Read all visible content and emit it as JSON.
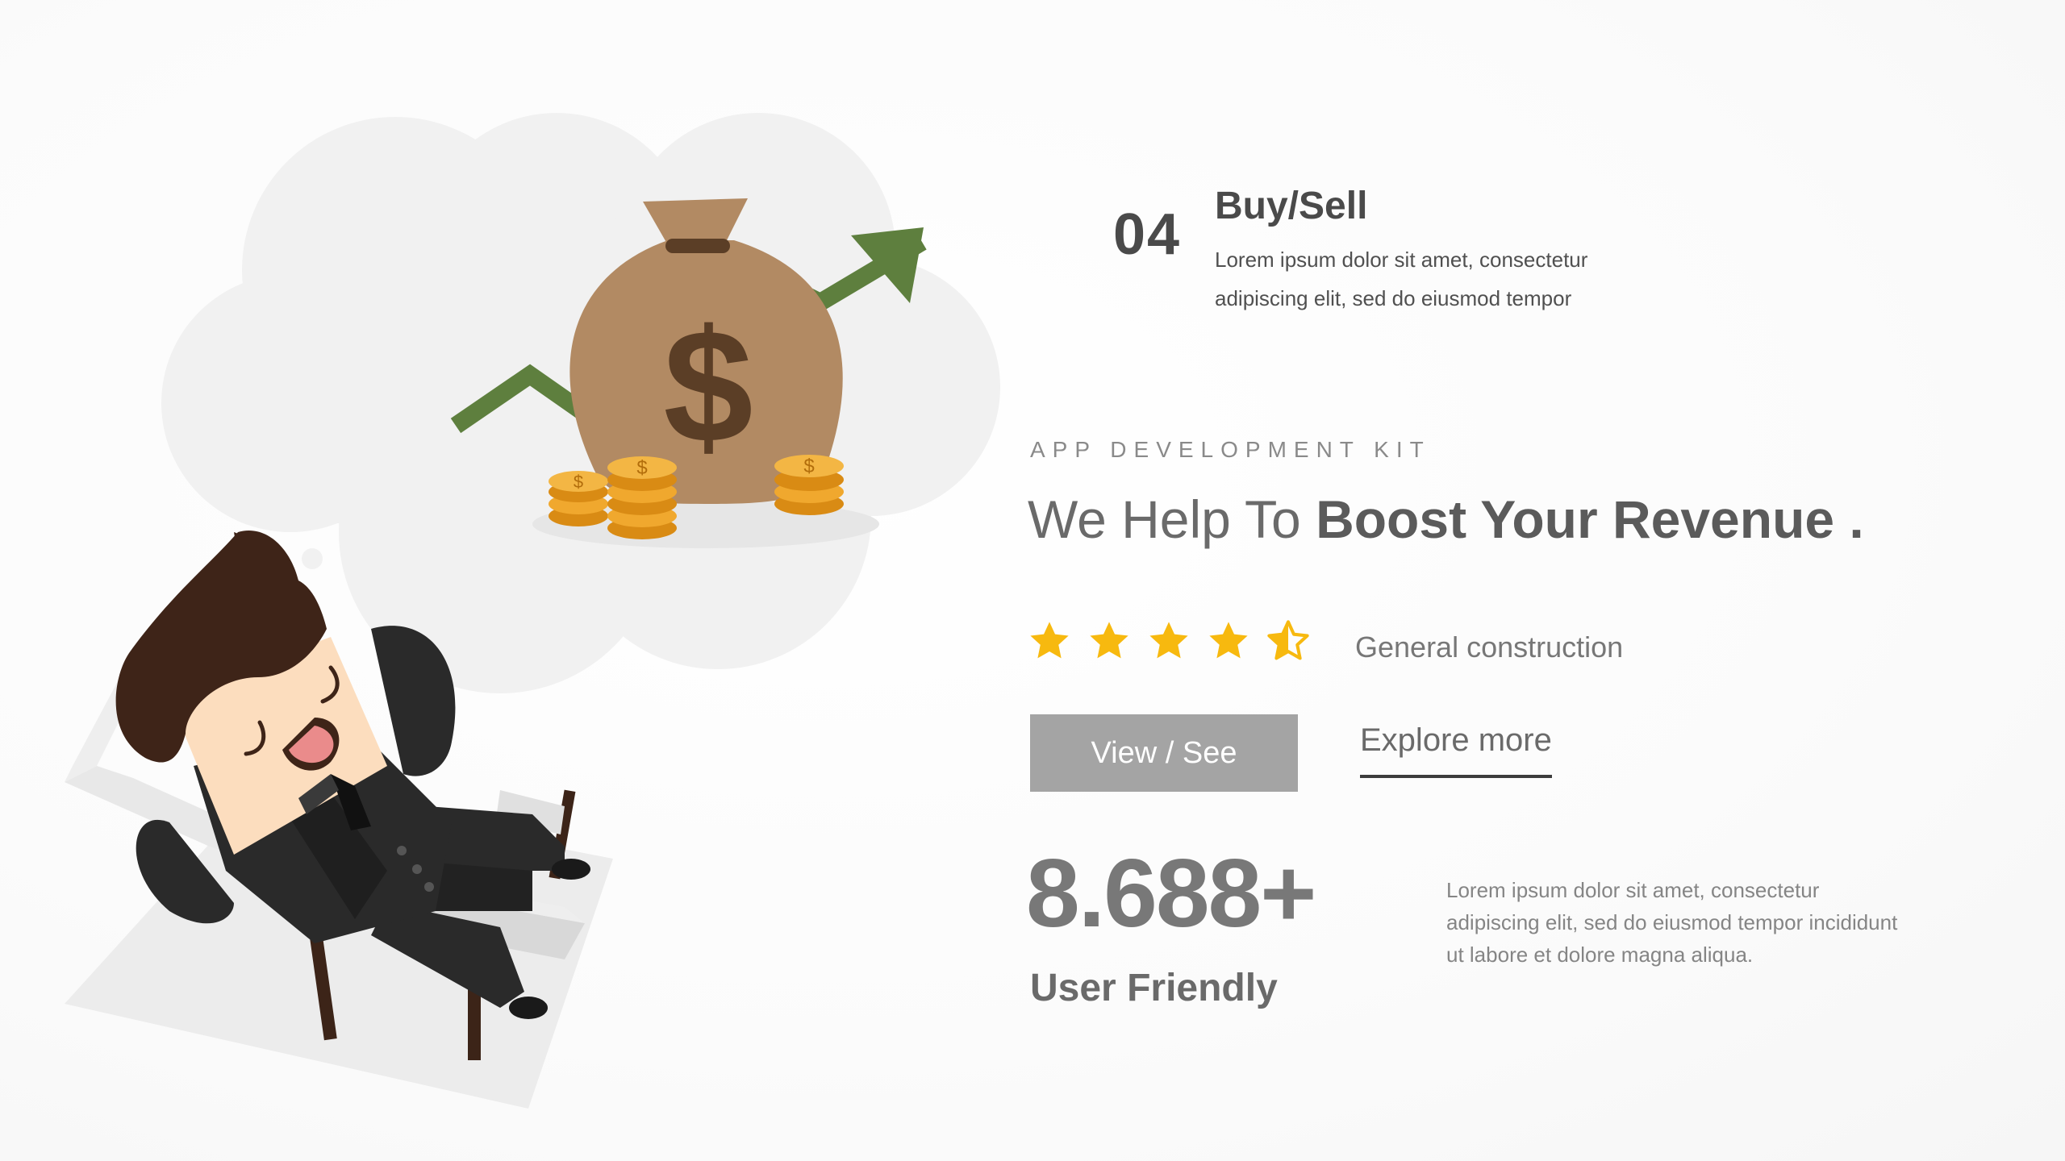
{
  "step": {
    "number": "04",
    "title": "Buy/Sell",
    "description": "Lorem ipsum dolor sit amet, consectetur adipiscing elit, sed do eiusmod tempor"
  },
  "hero": {
    "kicker": "APP DEVELOPMENT KIT",
    "headline_light": "We Help To ",
    "headline_bold": "Boost Your Revenue .",
    "rating": 4.5,
    "rating_max": 5,
    "rating_label": "General construction",
    "primary_button": "View / See",
    "secondary_link": "Explore more"
  },
  "stat": {
    "value": "8.688+",
    "label": "User Friendly",
    "description": "Lorem ipsum dolor sit amet, consectetur adipiscing elit, sed do eiusmod tempor incididunt ut labore et dolore magna aliqua."
  },
  "colors": {
    "star": "#F7B90F",
    "button": "#A4A4A4",
    "money_bag": "#B28A63",
    "dollar_sign": "#5B3E26",
    "trend_arrow": "#5E7F3E",
    "coin": "#F0A82E",
    "suit": "#2A2A2A",
    "hair": "#3E2418",
    "skin": "#FCDDBE"
  },
  "icons": {
    "illustration": "relaxing-businessman-dreaming-of-money",
    "star": "star-icon",
    "half_star": "half-star-icon"
  }
}
